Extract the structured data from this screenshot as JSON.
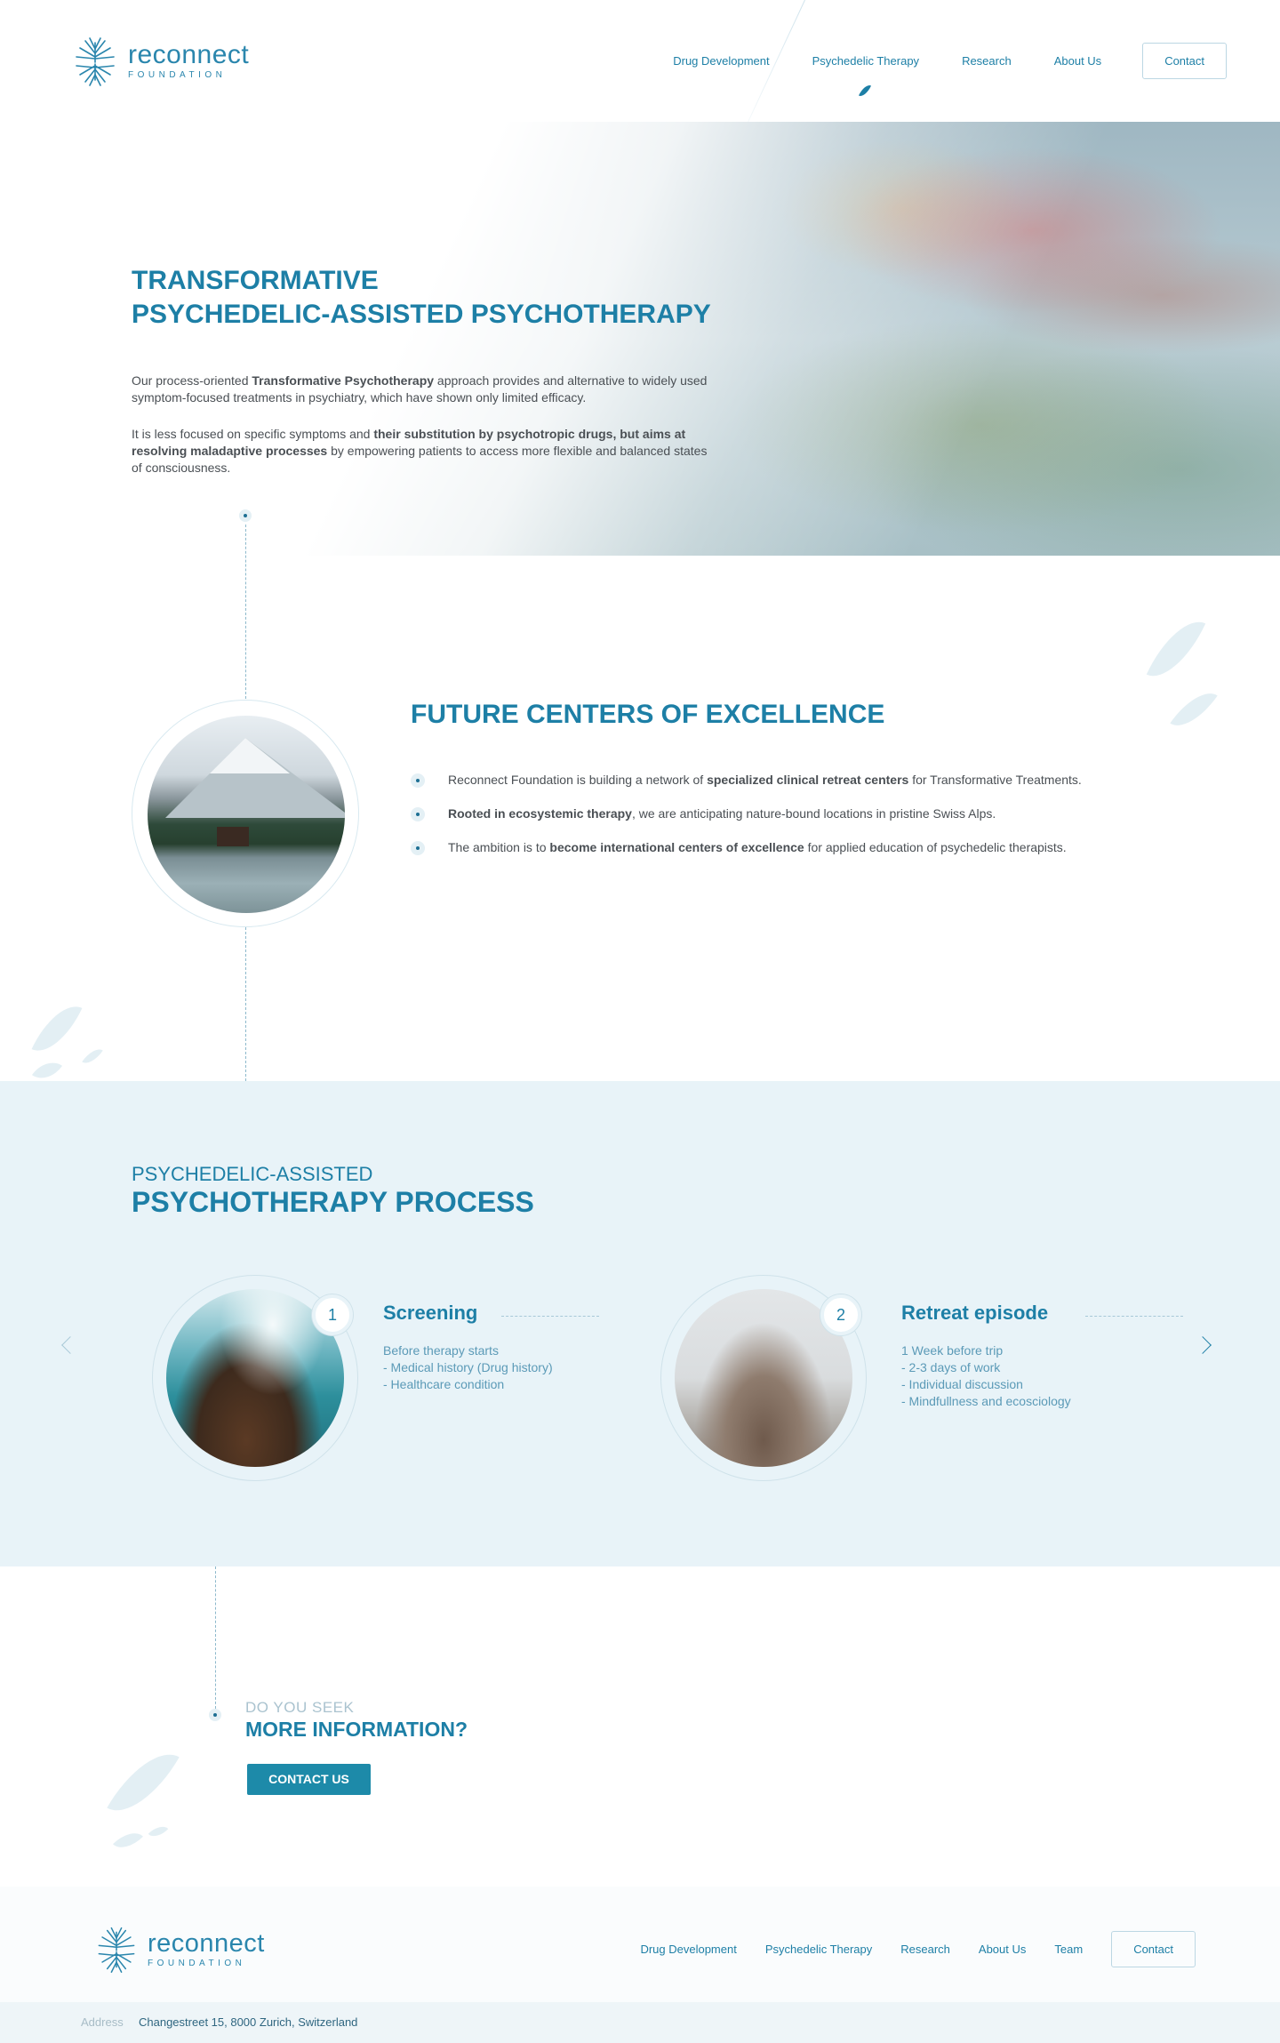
{
  "brand": {
    "name": "reconnect",
    "sub": "FOUNDATION",
    "color": "#1d7fa6"
  },
  "nav": {
    "items": [
      {
        "label": "Drug Development"
      },
      {
        "label": "Psychedelic Therapy",
        "active": true
      },
      {
        "label": "Research"
      },
      {
        "label": "About Us"
      }
    ],
    "contact": "Contact"
  },
  "hero": {
    "title_line1": "TRANSFORMATIVE",
    "title_line2": "PSYCHEDELIC-ASSISTED PSYCHOTHERAPY",
    "p1_a": "Our process-oriented ",
    "p1_b": "Transformative Psychotherapy",
    "p1_c": " approach provides and alternative to widely used symptom-focused treatments in psychiatry, which have shown only limited efficacy.",
    "p2_a": "It is less focused on specific symptoms and ",
    "p2_b": "their substitution by psychotropic drugs, but aims at resolving maladaptive processes",
    "p2_c": " by empowering patients to access more flexible and balanced states of consciousness."
  },
  "centers": {
    "title": "FUTURE CENTERS OF EXCELLENCE",
    "items": [
      {
        "a": "Reconnect Foundation is building a network of ",
        "b": "specialized clinical retreat centers",
        "c": " for Transformative Treatments."
      },
      {
        "a": "",
        "b": "Rooted in ecosystemic therapy",
        "c": ", we are anticipating nature-bound locations in pristine Swiss Alps."
      },
      {
        "a": "The ambition is to ",
        "b": "become international centers of excellence",
        "c": " for applied education of psychedelic therapists."
      }
    ]
  },
  "process": {
    "subtitle": "PSYCHEDELIC-ASSISTED",
    "title": "PSYCHOTHERAPY PROCESS",
    "steps": [
      {
        "num": "1",
        "title": "Screening",
        "lines": [
          "Before therapy starts",
          "- Medical history (Drug history)",
          "- Healthcare condition"
        ]
      },
      {
        "num": "2",
        "title": "Retreat episode",
        "lines": [
          "1 Week before trip",
          "- 2-3 days of work",
          "- Individual discussion",
          "- Mindfullness and ecosciology"
        ]
      }
    ]
  },
  "cta": {
    "subtitle": "DO YOU SEEK",
    "title": "MORE INFORMATION?",
    "button": "CONTACT US"
  },
  "footer": {
    "nav": [
      {
        "label": "Drug Development"
      },
      {
        "label": "Psychedelic Therapy"
      },
      {
        "label": "Research"
      },
      {
        "label": "About Us"
      },
      {
        "label": "Team"
      }
    ],
    "contact": "Contact",
    "address_label": "Address",
    "address": "Changestreet 15, 8000 Zurich, Switzerland"
  }
}
